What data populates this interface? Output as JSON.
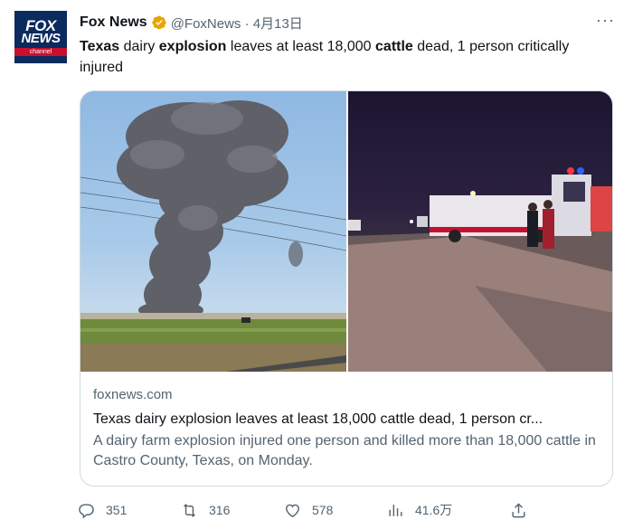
{
  "tweet": {
    "avatar": {
      "line1": "FOX",
      "line2": "NEWS",
      "line3": "channel"
    },
    "display_name": "Fox News",
    "handle_date": "@FoxNews · 4月13日",
    "text_parts": [
      {
        "t": "Texas",
        "bold": true
      },
      {
        "t": " dairy ",
        "bold": false
      },
      {
        "t": "explosion",
        "bold": true
      },
      {
        "t": " leaves at least 18,000 ",
        "bold": false
      },
      {
        "t": "cattle",
        "bold": true
      },
      {
        "t": " dead, 1 person critically injured",
        "bold": false
      }
    ]
  },
  "card": {
    "domain": "foxnews.com",
    "title": "Texas dairy explosion leaves at least 18,000 cattle dead, 1 person cr...",
    "description": "A dairy farm explosion injured one person and killed more than 18,000 cattle in Castro County, Texas, on Monday."
  },
  "actions": {
    "reply_count": "351",
    "retweet_count": "316",
    "like_count": "578",
    "views_count": "41.6万"
  },
  "colors": {
    "verified": "#e8a400",
    "secondary_text": "#536471",
    "border": "#cfd9de",
    "fox_blue": "#0b2a5e",
    "fox_red": "#c8102e"
  }
}
